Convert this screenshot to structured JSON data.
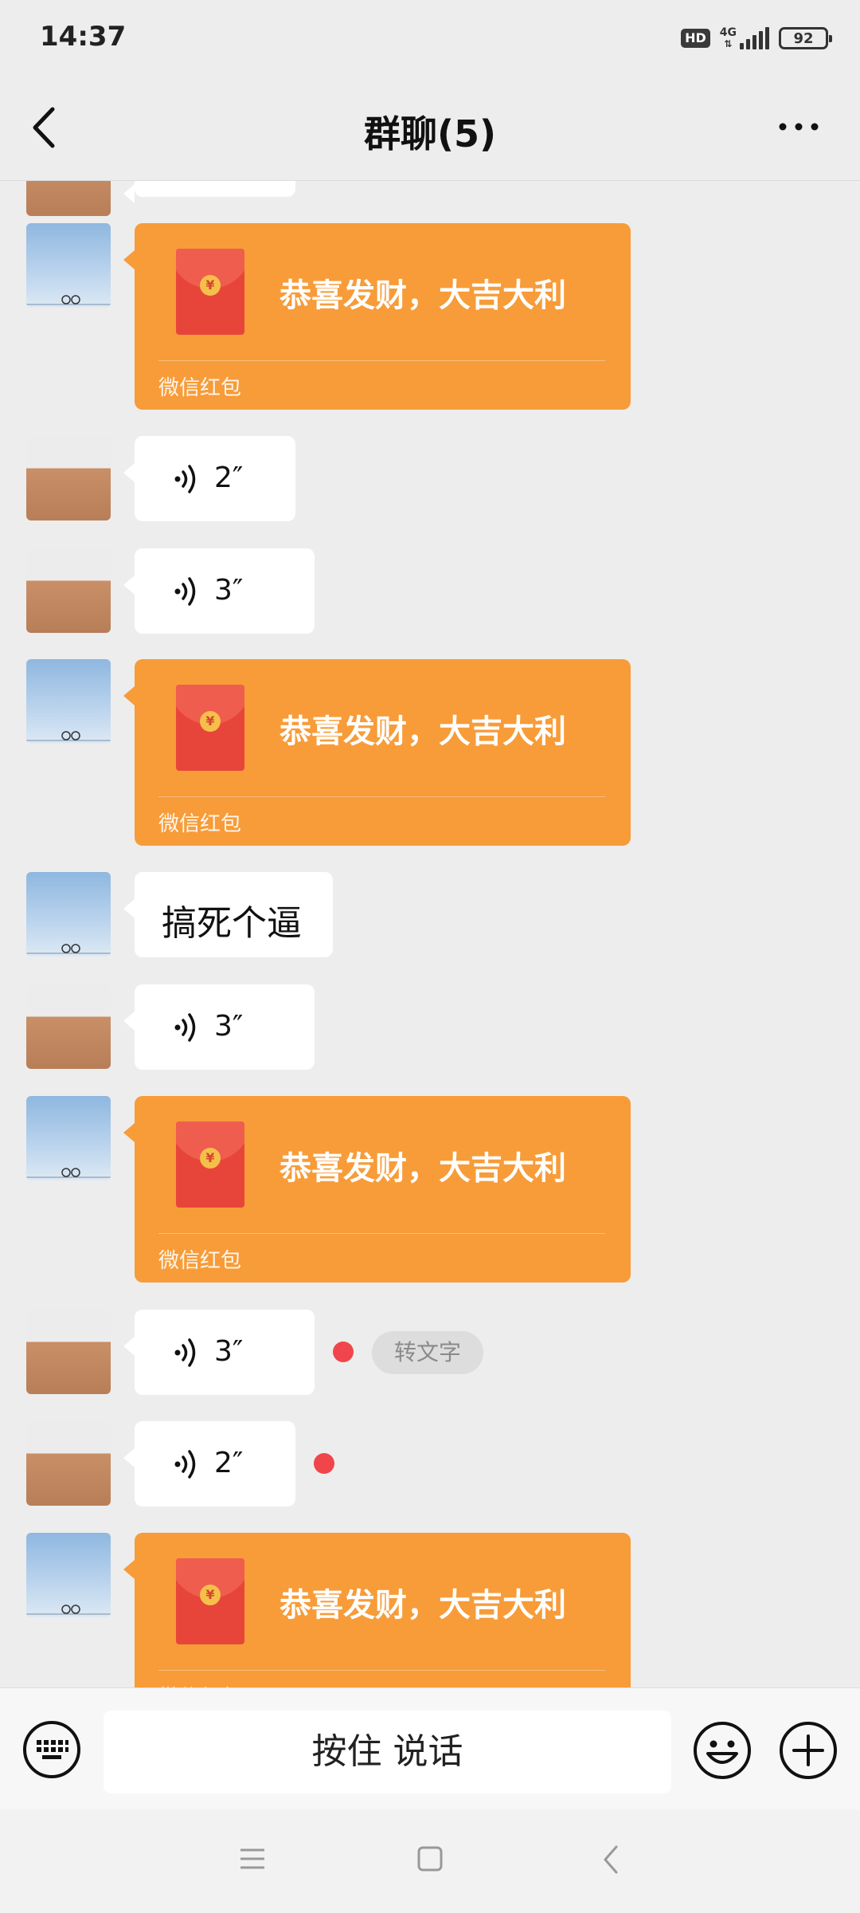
{
  "status_bar": {
    "time": "14:37",
    "hd_label": "HD",
    "network_label": "4G",
    "battery": "92"
  },
  "header": {
    "title": "群聊(5)",
    "back_icon": "chevron-left-icon",
    "more_icon": "more-dots-icon"
  },
  "messages": [
    {
      "type": "red_packet",
      "sender": "sky-avatar",
      "text": "恭喜发财，大吉大利",
      "footer": "微信红包"
    },
    {
      "type": "voice",
      "sender": "kid-avatar",
      "duration": "2″"
    },
    {
      "type": "voice",
      "sender": "kid-avatar",
      "duration": "3″"
    },
    {
      "type": "red_packet",
      "sender": "sky-avatar",
      "text": "恭喜发财，大吉大利",
      "footer": "微信红包"
    },
    {
      "type": "text",
      "sender": "sky-avatar",
      "text": "搞死个逼"
    },
    {
      "type": "voice",
      "sender": "kid-avatar",
      "duration": "3″"
    },
    {
      "type": "red_packet",
      "sender": "sky-avatar",
      "text": "恭喜发财，大吉大利",
      "footer": "微信红包"
    },
    {
      "type": "voice",
      "sender": "kid-avatar",
      "duration": "3″",
      "unread": true,
      "action": "转文字"
    },
    {
      "type": "voice",
      "sender": "kid-avatar",
      "duration": "2″",
      "unread": true
    },
    {
      "type": "red_packet",
      "sender": "sky-avatar",
      "text": "恭喜发财，大吉大利",
      "footer": "微信红包"
    }
  ],
  "input_bar": {
    "hold_to_talk": "按住 说话",
    "keyboard_icon": "keyboard-icon",
    "emoji_icon": "emoji-icon",
    "plus_icon": "plus-icon"
  },
  "colors": {
    "background": "#ededed",
    "red_packet": "#f79c39",
    "envelope": "#e8453a",
    "unread_dot": "#f0454a"
  }
}
